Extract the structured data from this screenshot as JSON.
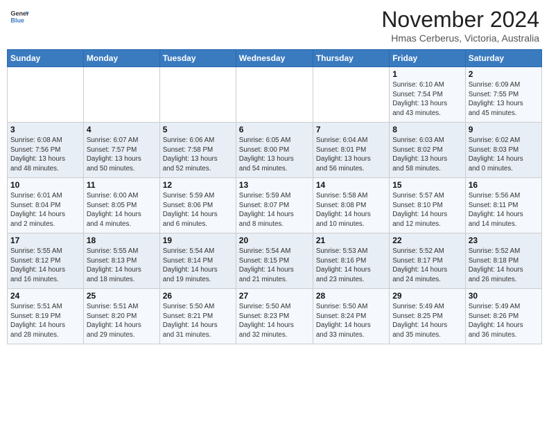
{
  "header": {
    "logo_line1": "General",
    "logo_line2": "Blue",
    "month": "November 2024",
    "location": "Hmas Cerberus, Victoria, Australia"
  },
  "weekdays": [
    "Sunday",
    "Monday",
    "Tuesday",
    "Wednesday",
    "Thursday",
    "Friday",
    "Saturday"
  ],
  "weeks": [
    [
      {
        "day": "",
        "info": ""
      },
      {
        "day": "",
        "info": ""
      },
      {
        "day": "",
        "info": ""
      },
      {
        "day": "",
        "info": ""
      },
      {
        "day": "",
        "info": ""
      },
      {
        "day": "1",
        "info": "Sunrise: 6:10 AM\nSunset: 7:54 PM\nDaylight: 13 hours\nand 43 minutes."
      },
      {
        "day": "2",
        "info": "Sunrise: 6:09 AM\nSunset: 7:55 PM\nDaylight: 13 hours\nand 45 minutes."
      }
    ],
    [
      {
        "day": "3",
        "info": "Sunrise: 6:08 AM\nSunset: 7:56 PM\nDaylight: 13 hours\nand 48 minutes."
      },
      {
        "day": "4",
        "info": "Sunrise: 6:07 AM\nSunset: 7:57 PM\nDaylight: 13 hours\nand 50 minutes."
      },
      {
        "day": "5",
        "info": "Sunrise: 6:06 AM\nSunset: 7:58 PM\nDaylight: 13 hours\nand 52 minutes."
      },
      {
        "day": "6",
        "info": "Sunrise: 6:05 AM\nSunset: 8:00 PM\nDaylight: 13 hours\nand 54 minutes."
      },
      {
        "day": "7",
        "info": "Sunrise: 6:04 AM\nSunset: 8:01 PM\nDaylight: 13 hours\nand 56 minutes."
      },
      {
        "day": "8",
        "info": "Sunrise: 6:03 AM\nSunset: 8:02 PM\nDaylight: 13 hours\nand 58 minutes."
      },
      {
        "day": "9",
        "info": "Sunrise: 6:02 AM\nSunset: 8:03 PM\nDaylight: 14 hours\nand 0 minutes."
      }
    ],
    [
      {
        "day": "10",
        "info": "Sunrise: 6:01 AM\nSunset: 8:04 PM\nDaylight: 14 hours\nand 2 minutes."
      },
      {
        "day": "11",
        "info": "Sunrise: 6:00 AM\nSunset: 8:05 PM\nDaylight: 14 hours\nand 4 minutes."
      },
      {
        "day": "12",
        "info": "Sunrise: 5:59 AM\nSunset: 8:06 PM\nDaylight: 14 hours\nand 6 minutes."
      },
      {
        "day": "13",
        "info": "Sunrise: 5:59 AM\nSunset: 8:07 PM\nDaylight: 14 hours\nand 8 minutes."
      },
      {
        "day": "14",
        "info": "Sunrise: 5:58 AM\nSunset: 8:08 PM\nDaylight: 14 hours\nand 10 minutes."
      },
      {
        "day": "15",
        "info": "Sunrise: 5:57 AM\nSunset: 8:10 PM\nDaylight: 14 hours\nand 12 minutes."
      },
      {
        "day": "16",
        "info": "Sunrise: 5:56 AM\nSunset: 8:11 PM\nDaylight: 14 hours\nand 14 minutes."
      }
    ],
    [
      {
        "day": "17",
        "info": "Sunrise: 5:55 AM\nSunset: 8:12 PM\nDaylight: 14 hours\nand 16 minutes."
      },
      {
        "day": "18",
        "info": "Sunrise: 5:55 AM\nSunset: 8:13 PM\nDaylight: 14 hours\nand 18 minutes."
      },
      {
        "day": "19",
        "info": "Sunrise: 5:54 AM\nSunset: 8:14 PM\nDaylight: 14 hours\nand 19 minutes."
      },
      {
        "day": "20",
        "info": "Sunrise: 5:54 AM\nSunset: 8:15 PM\nDaylight: 14 hours\nand 21 minutes."
      },
      {
        "day": "21",
        "info": "Sunrise: 5:53 AM\nSunset: 8:16 PM\nDaylight: 14 hours\nand 23 minutes."
      },
      {
        "day": "22",
        "info": "Sunrise: 5:52 AM\nSunset: 8:17 PM\nDaylight: 14 hours\nand 24 minutes."
      },
      {
        "day": "23",
        "info": "Sunrise: 5:52 AM\nSunset: 8:18 PM\nDaylight: 14 hours\nand 26 minutes."
      }
    ],
    [
      {
        "day": "24",
        "info": "Sunrise: 5:51 AM\nSunset: 8:19 PM\nDaylight: 14 hours\nand 28 minutes."
      },
      {
        "day": "25",
        "info": "Sunrise: 5:51 AM\nSunset: 8:20 PM\nDaylight: 14 hours\nand 29 minutes."
      },
      {
        "day": "26",
        "info": "Sunrise: 5:50 AM\nSunset: 8:21 PM\nDaylight: 14 hours\nand 31 minutes."
      },
      {
        "day": "27",
        "info": "Sunrise: 5:50 AM\nSunset: 8:23 PM\nDaylight: 14 hours\nand 32 minutes."
      },
      {
        "day": "28",
        "info": "Sunrise: 5:50 AM\nSunset: 8:24 PM\nDaylight: 14 hours\nand 33 minutes."
      },
      {
        "day": "29",
        "info": "Sunrise: 5:49 AM\nSunset: 8:25 PM\nDaylight: 14 hours\nand 35 minutes."
      },
      {
        "day": "30",
        "info": "Sunrise: 5:49 AM\nSunset: 8:26 PM\nDaylight: 14 hours\nand 36 minutes."
      }
    ]
  ]
}
